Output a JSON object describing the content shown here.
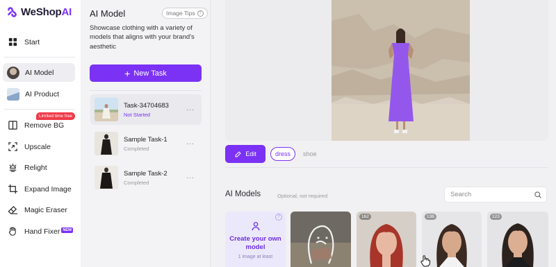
{
  "brand": {
    "name": "WeShop",
    "suffix": "AI"
  },
  "nav": {
    "items": [
      {
        "label": "Start",
        "icon": "grid-icon"
      },
      {
        "label": "AI Model",
        "icon": "avatar",
        "active": true
      },
      {
        "label": "AI Product",
        "icon": "product-thumb-icon"
      },
      {
        "label": "Remove BG",
        "icon": "split-panel-icon"
      },
      {
        "label": "Upscale",
        "icon": "upscale-icon"
      },
      {
        "label": "Relight",
        "icon": "lamp-icon"
      },
      {
        "label": "Expand Image",
        "icon": "crop-expand-icon"
      },
      {
        "label": "Magic Eraser",
        "icon": "eraser-icon"
      },
      {
        "label": "Hand Fixer",
        "icon": "hand-icon"
      }
    ],
    "promo_badge": "Limited time free",
    "new_badge": "NEW"
  },
  "task_panel": {
    "title": "AI Model",
    "tips_label": "Image Tips",
    "description": "Showcase clothing with a variety of models that aligns with your brand's aesthetic",
    "new_task_label": "New Task",
    "tasks": [
      {
        "name": "Task-34704683",
        "status": "Not Started",
        "active": true
      },
      {
        "name": "Sample Task-1",
        "status": "Completed"
      },
      {
        "name": "Sample Task-2",
        "status": "Completed"
      }
    ],
    "more_label": "···"
  },
  "main": {
    "edit_label": "Edit",
    "tags": [
      "dress",
      "shoe"
    ],
    "models_title": "AI Models",
    "models_subtitle": "Optional, not required",
    "search_placeholder": "Search",
    "create_card": {
      "title": "Create your own model",
      "subtitle": "1 image at least",
      "help": "?"
    },
    "model_counts": [
      "162",
      "136",
      "123"
    ]
  },
  "colors": {
    "accent": "#7b32f5",
    "promo": "#ef3b4a"
  }
}
